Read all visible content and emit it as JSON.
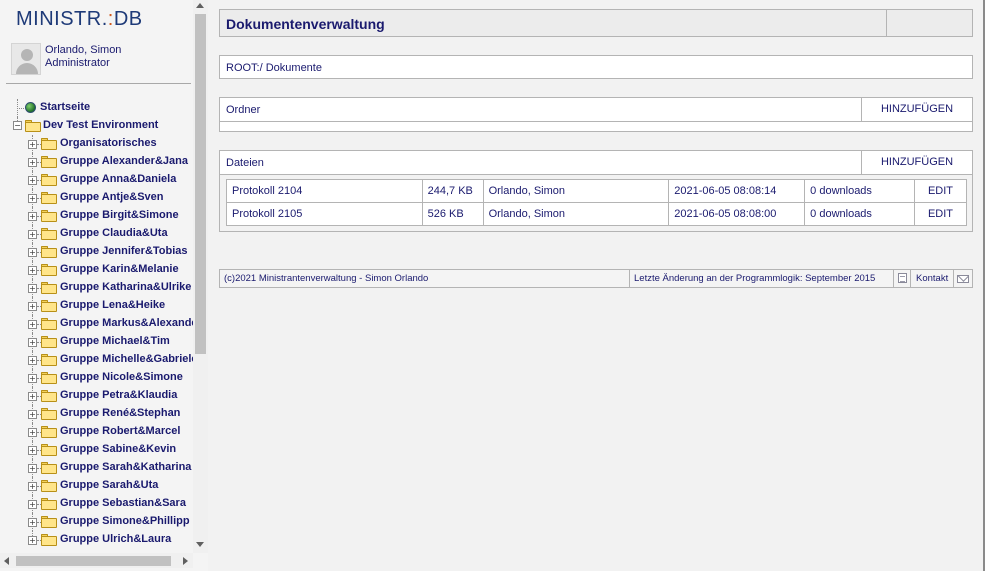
{
  "app": {
    "logo_main": "MINISTR.",
    "logo_accent": ":",
    "logo_tail": "DB"
  },
  "user": {
    "name": "Orlando, Simon",
    "role": "Administrator"
  },
  "tree": {
    "home": "Startseite",
    "root": "Dev Test Environment",
    "folders": [
      "Organisatorisches",
      "Gruppe Alexander&Jana",
      "Gruppe Anna&Daniela",
      "Gruppe Antje&Sven",
      "Gruppe Birgit&Simone",
      "Gruppe Claudia&Uta",
      "Gruppe Jennifer&Tobias",
      "Gruppe Karin&Melanie",
      "Gruppe Katharina&Ulrike",
      "Gruppe Lena&Heike",
      "Gruppe Markus&Alexander",
      "Gruppe Michael&Tim",
      "Gruppe Michelle&Gabriele",
      "Gruppe Nicole&Simone",
      "Gruppe Petra&Klaudia",
      "Gruppe René&Stephan",
      "Gruppe Robert&Marcel",
      "Gruppe Sabine&Kevin",
      "Gruppe Sarah&Katharina",
      "Gruppe Sarah&Uta",
      "Gruppe Sebastian&Sara",
      "Gruppe Simone&Phillipp",
      "Gruppe Ulrich&Laura"
    ]
  },
  "main": {
    "title": "Dokumentenverwaltung",
    "path": "ROOT:/ Dokumente",
    "folders_section": {
      "label": "Ordner",
      "add_label": "HINZUFÜGEN"
    },
    "files_section": {
      "label": "Dateien",
      "add_label": "HINZUFÜGEN",
      "rows": [
        {
          "name": "Protokoll 2104",
          "size": "244,7 KB",
          "owner": "Orlando, Simon",
          "date": "2021-06-05 08:08:14",
          "downloads": "0 downloads",
          "action": "EDIT"
        },
        {
          "name": "Protokoll 2105",
          "size": "526 KB",
          "owner": "Orlando, Simon",
          "date": "2021-06-05 08:08:00",
          "downloads": "0 downloads",
          "action": "EDIT"
        }
      ]
    }
  },
  "footer": {
    "copyright": "(c)2021 Ministrantenverwaltung - Simon Orlando",
    "last_change": "Letzte Änderung an der Programmlogik: September 2015",
    "contact": "Kontakt"
  },
  "colors": {
    "text_navy": "#1a1a6e",
    "logo_blue": "#1e3a78",
    "logo_accent": "#d05a1e",
    "border": "#b4b4b4",
    "background": "#f2f2f2"
  },
  "icons": [
    "globe-icon",
    "folder-icon",
    "expand-plus-icon",
    "collapse-minus-icon",
    "document-icon",
    "mail-icon"
  ]
}
